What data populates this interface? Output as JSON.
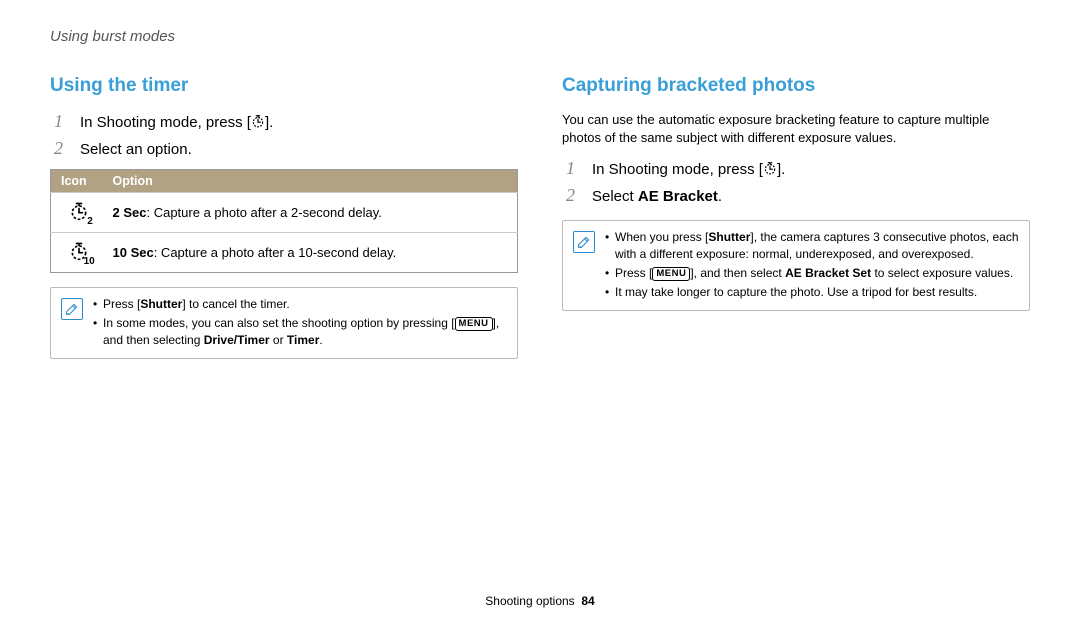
{
  "header": "Using burst modes",
  "left": {
    "title": "Using the timer",
    "steps": [
      {
        "num": "1",
        "pre": "In Shooting mode, press [",
        "post": "]."
      },
      {
        "num": "2",
        "text": "Select an option."
      }
    ],
    "table": {
      "h1": "Icon",
      "h2": "Option",
      "rows": [
        {
          "icon_sub": "2",
          "bold": "2 Sec",
          "rest": ": Capture a photo after a 2-second delay."
        },
        {
          "icon_sub": "10",
          "bold": "10 Sec",
          "rest": ": Capture a photo after a 10-second delay."
        }
      ]
    },
    "note": [
      {
        "parts": [
          {
            "t": "Press ["
          },
          {
            "b": "Shutter"
          },
          {
            "t": "] to cancel the timer."
          }
        ]
      },
      {
        "parts": [
          {
            "t": "In some modes, you can also set the shooting option by pressing ["
          },
          {
            "menu": true
          },
          {
            "t": "], and then selecting "
          },
          {
            "b": "Drive/Timer"
          },
          {
            "t": " or "
          },
          {
            "b": "Timer"
          },
          {
            "t": "."
          }
        ]
      }
    ]
  },
  "right": {
    "title": "Capturing bracketed photos",
    "intro": "You can use the automatic exposure bracketing feature to capture multiple photos of the same subject with different exposure values.",
    "steps": [
      {
        "num": "1",
        "pre": "In Shooting mode, press [",
        "post": "]."
      },
      {
        "num": "2",
        "pre": "Select ",
        "bold": "AE Bracket",
        "post": "."
      }
    ],
    "note": [
      {
        "parts": [
          {
            "t": "When you press ["
          },
          {
            "b": "Shutter"
          },
          {
            "t": "], the camera captures 3 consecutive photos, each with a different exposure: normal, underexposed, and overexposed."
          }
        ]
      },
      {
        "parts": [
          {
            "t": "Press ["
          },
          {
            "menu": true
          },
          {
            "t": "], and then select "
          },
          {
            "b": "AE Bracket Set"
          },
          {
            "t": " to select exposure values."
          }
        ]
      },
      {
        "parts": [
          {
            "t": "It may take longer to capture the photo. Use a tripod for best results."
          }
        ]
      }
    ]
  },
  "footer": {
    "section": "Shooting options",
    "page": "84"
  },
  "menu_label": "MENU"
}
